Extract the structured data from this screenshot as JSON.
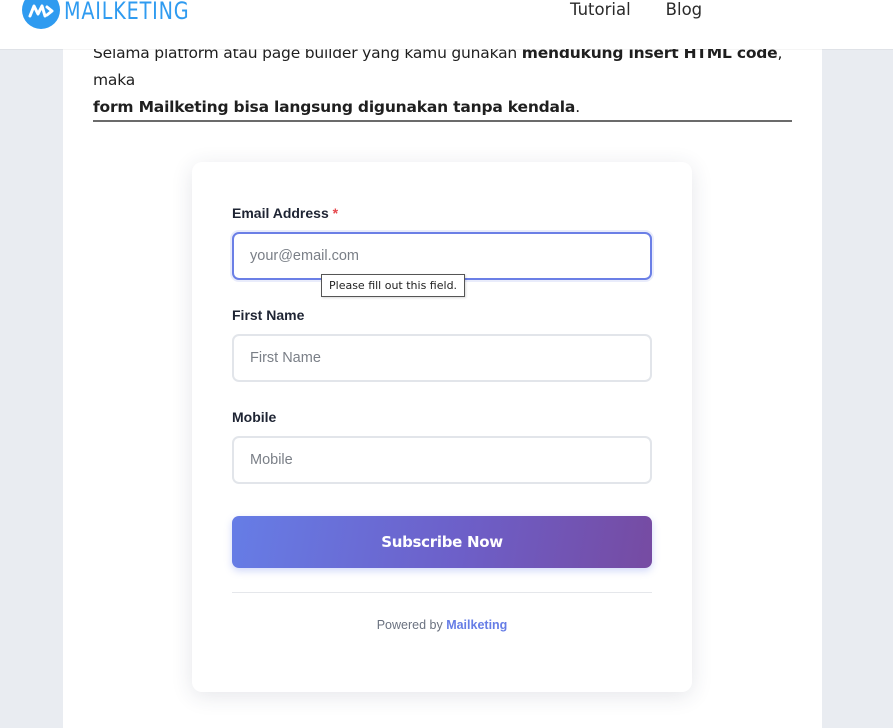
{
  "header": {
    "logo_text": "MAILKETING",
    "nav": [
      {
        "label": "Tutorial"
      },
      {
        "label": "Blog"
      }
    ]
  },
  "intro": {
    "part1": "Selama platform atau page builder yang kamu gunakan ",
    "bold1": "mendukung insert HTML code",
    "part2": ", maka ",
    "bold2": "form Mailketing bisa langsung digunakan tanpa kendala",
    "part3": "."
  },
  "form": {
    "email": {
      "label": "Email Address",
      "required_mark": "*",
      "placeholder": "your@email.com",
      "value": ""
    },
    "validation_tooltip": "Please fill out this field.",
    "first_name": {
      "label": "First Name",
      "placeholder": "First Name",
      "value": ""
    },
    "mobile": {
      "label": "Mobile",
      "placeholder": "Mobile",
      "value": ""
    },
    "submit_label": "Subscribe Now",
    "powered_prefix": "Powered by",
    "powered_brand": "Mailketing"
  },
  "colors": {
    "accent": "#667de6",
    "gradient_end": "#764ba2",
    "logo_blue": "#2f9bf0",
    "required_red": "#e5484d"
  }
}
